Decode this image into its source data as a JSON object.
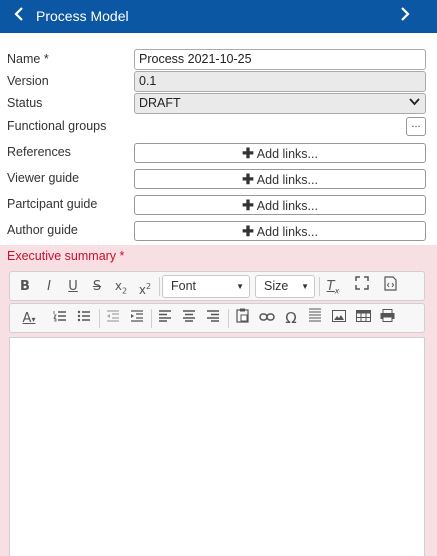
{
  "header": {
    "title": "Process Model",
    "back_icon": "chevron-left-icon",
    "forward_icon": "chevron-right-icon",
    "background": "#0b57a4"
  },
  "form": {
    "name": {
      "label": "Name *",
      "value": "Process 2021-10-25"
    },
    "version": {
      "label": "Version",
      "value": "0.1"
    },
    "status": {
      "label": "Status",
      "value": "DRAFT"
    },
    "functional_groups": {
      "label": "Functional groups",
      "button": "..."
    },
    "references": {
      "label": "References",
      "button": "Add links..."
    },
    "viewer_guide": {
      "label": "Viewer guide",
      "button": "Add links..."
    },
    "participant_guide": {
      "label": "Partcipant guide",
      "button": "Add links..."
    },
    "author_guide": {
      "label": "Author guide",
      "button": "Add links..."
    }
  },
  "editor": {
    "label": "Executive summary *",
    "label_color": "#c8102e",
    "background": "#f8dfe3",
    "font_combo": "Font",
    "size_combo": "Size",
    "toolbar_row1_icons": [
      "bold-icon",
      "italic-icon",
      "underline-icon",
      "strikethrough-icon",
      "subscript-icon",
      "superscript-icon",
      "remove-format-icon",
      "maximize-icon",
      "source-icon"
    ],
    "toolbar_row2_icons": [
      "text-color-icon",
      "numbered-list-icon",
      "bulleted-list-icon",
      "outdent-icon",
      "indent-icon",
      "align-left-icon",
      "align-center-icon",
      "align-right-icon",
      "paste-icon",
      "link-icon",
      "special-char-icon",
      "horizontal-rule-icon",
      "image-icon",
      "table-icon",
      "print-icon"
    ]
  }
}
